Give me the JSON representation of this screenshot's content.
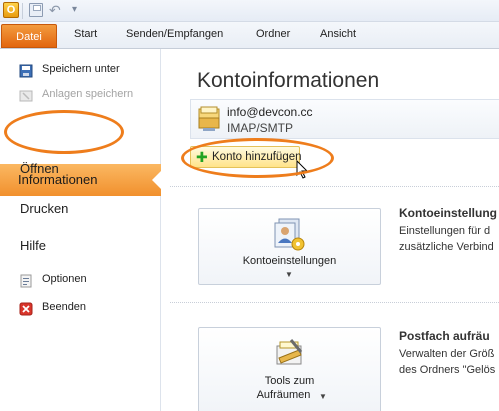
{
  "app": {
    "icon_letter": "O"
  },
  "qat": {
    "save_icon": "save-icon",
    "undo_icon": "undo-icon",
    "more_icon": "customize-qat-icon"
  },
  "tabs": [
    {
      "label": "Datei"
    },
    {
      "label": "Start"
    },
    {
      "label": "Senden/Empfangen"
    },
    {
      "label": "Ordner"
    },
    {
      "label": "Ansicht"
    }
  ],
  "left_menu": {
    "save_as": "Speichern unter",
    "save_attachments": "Anlagen speichern",
    "info": "Informationen",
    "open": "Öffnen",
    "print": "Drucken",
    "help": "Hilfe",
    "options": "Optionen",
    "exit": "Beenden"
  },
  "main": {
    "heading": "Kontoinformationen",
    "account": {
      "email": "info@devcon.cc",
      "type": "IMAP/SMTP"
    },
    "add_account_label": "Konto hinzufügen",
    "sections": [
      {
        "button_label": "Kontoeinstellungen",
        "title": "Kontoeinstellung",
        "lines": [
          "Einstellungen für d",
          "zusätzliche Verbind"
        ]
      },
      {
        "button_label_line1": "Tools zum",
        "button_label_line2": "Aufräumen",
        "title": "Postfach aufräu",
        "lines": [
          "Verwalten der Größ",
          "des Ordners \"Gelös"
        ]
      }
    ]
  },
  "colors": {
    "accent": "#ee7d1c",
    "file_tab": "#e2660f",
    "active_item": "#f1902d"
  }
}
